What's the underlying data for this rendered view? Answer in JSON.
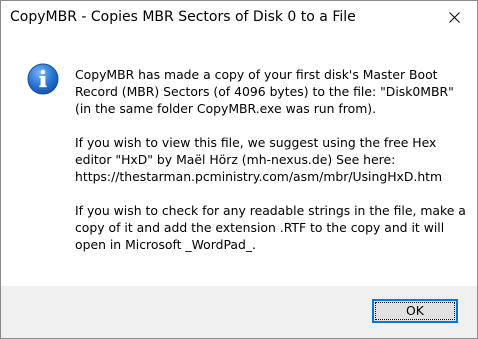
{
  "window": {
    "title": "CopyMBR - Copies MBR Sectors of Disk 0 to a File",
    "close_icon": "close-icon"
  },
  "dialog": {
    "icon": "info-icon",
    "paragraphs": [
      "CopyMBR has made a copy of your first disk's Master Boot\nRecord (MBR) Sectors (of 4096 bytes) to the file: \"Disk0MBR\"\n(in the same folder CopyMBR.exe was run from).",
      "If you wish to view this file, we suggest using the free Hex\neditor \"HxD\" by Maël Hörz (mh-nexus.de) See here:\nhttps://thestarman.pcministry.com/asm/mbr/UsingHxD.htm",
      "If you wish to check for any readable strings in the file, make a\ncopy of it and add the extension .RTF to the copy and it will\nopen in Microsoft _WordPad_."
    ]
  },
  "footer": {
    "ok_label": "OK"
  },
  "colors": {
    "accent": "#0078d7",
    "footer_bg": "#f0f0f0",
    "button_bg": "#e1e1e1",
    "icon_blue": "#1f6fd1"
  }
}
